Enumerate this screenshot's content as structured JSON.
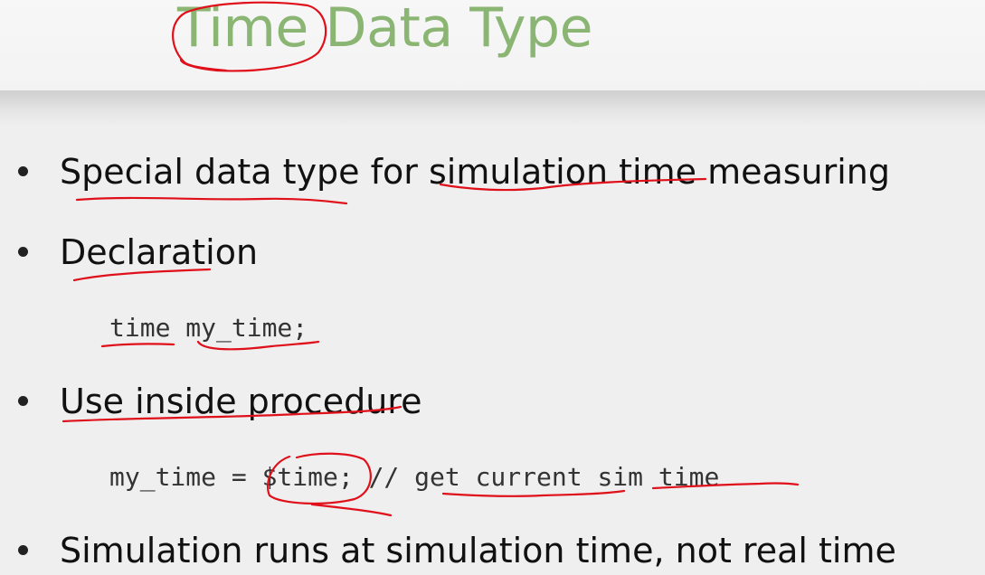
{
  "slide": {
    "title": "Time Data Type",
    "bullets": [
      "Special data type for simulation time measuring",
      "Declaration",
      "Use inside procedure",
      "Simulation runs at simulation time, not real time"
    ],
    "code": [
      "time my_time;",
      "my_time = $time; // get current sim time"
    ]
  }
}
